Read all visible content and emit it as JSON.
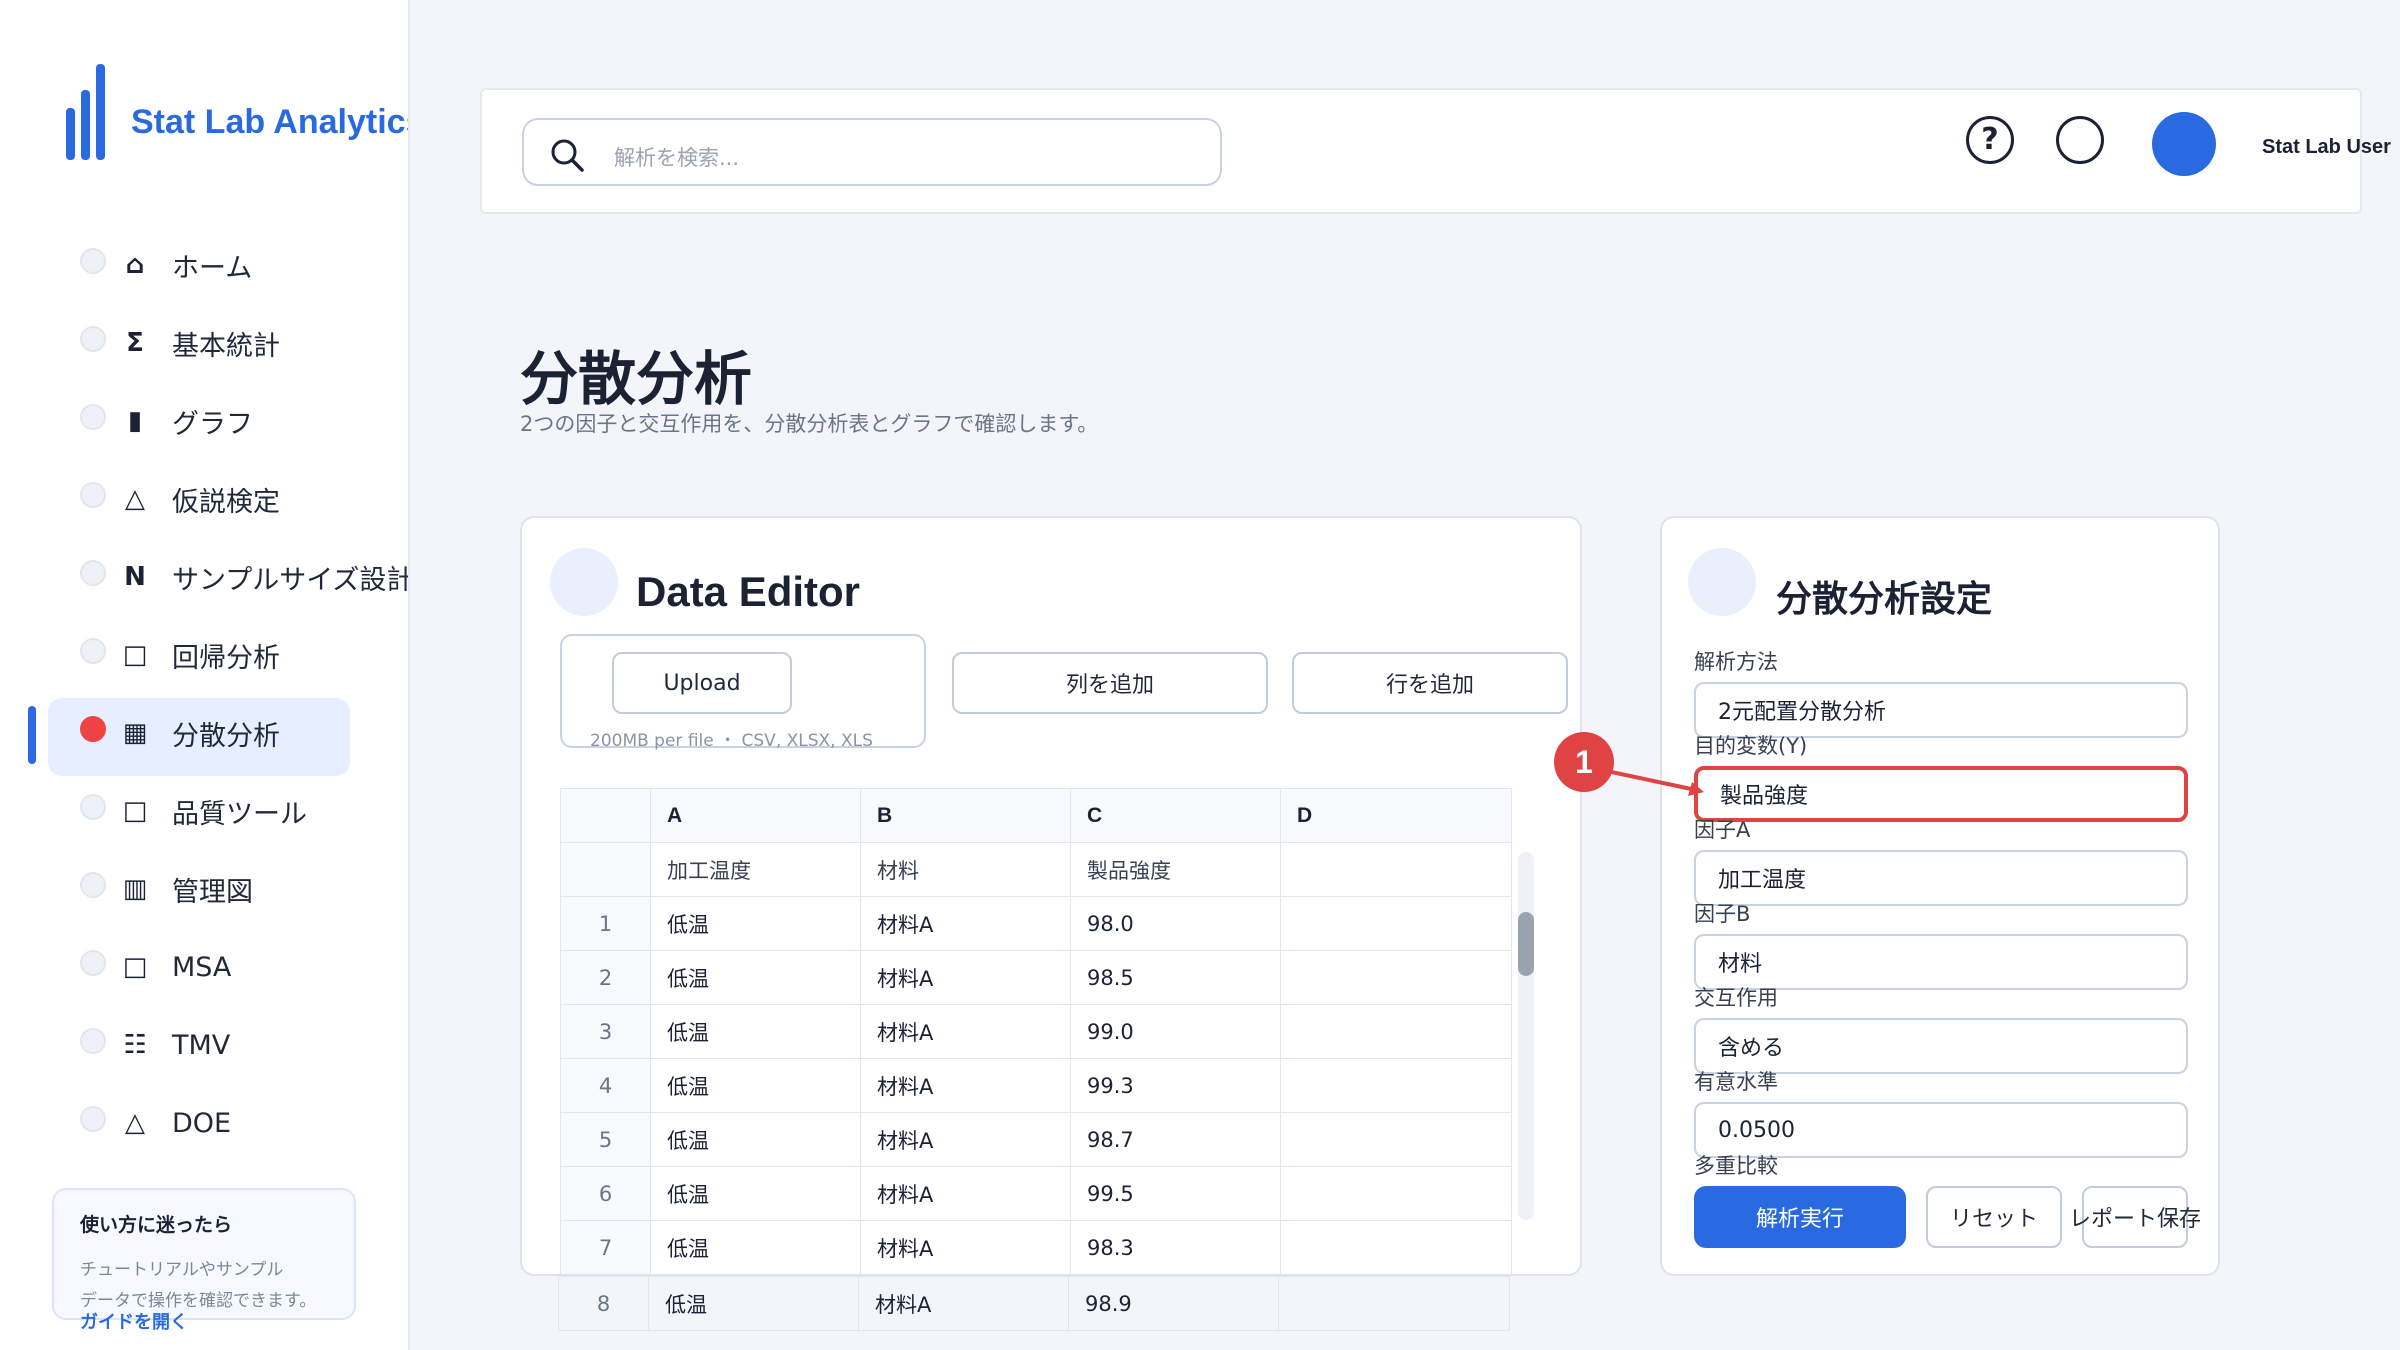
{
  "app": {
    "name": "Stat Lab Analytics",
    "brand_color": "#2a6ae0"
  },
  "sidebar": {
    "items": [
      {
        "label": "ホーム",
        "icon": "⌂",
        "icon_name": "home-icon"
      },
      {
        "label": "基本統計",
        "icon": "Σ",
        "icon_name": "sigma-icon"
      },
      {
        "label": "グラフ",
        "icon": "▮",
        "icon_name": "chart-icon"
      },
      {
        "label": "仮説検定",
        "icon": "△",
        "icon_name": "triangle-icon"
      },
      {
        "label": "サンプルサイズ設計",
        "icon": "N",
        "icon_name": "n-icon"
      },
      {
        "label": "回帰分析",
        "icon": "□",
        "icon_name": "square-icon"
      },
      {
        "label": "分散分析",
        "icon": "▦",
        "icon_name": "grid-icon",
        "active": true
      },
      {
        "label": "品質ツール",
        "icon": "□",
        "icon_name": "square-icon"
      },
      {
        "label": "管理図",
        "icon": "▥",
        "icon_name": "control-chart-icon"
      },
      {
        "label": "MSA",
        "icon": "□",
        "icon_name": "square-icon"
      },
      {
        "label": "TMV",
        "icon": "☷",
        "icon_name": "list-icon"
      },
      {
        "label": "DOE",
        "icon": "△",
        "icon_name": "triangle-icon"
      }
    ],
    "help": {
      "title": "使い方に迷ったら",
      "text_line1": "チュートリアルやサンプル",
      "text_line2": "データで操作を確認できます。",
      "link": "ガイドを開く"
    }
  },
  "header": {
    "search_placeholder": "解析を検索...",
    "help_icon": "?",
    "user_name": "Stat Lab User"
  },
  "page": {
    "title": "分散分析",
    "subtitle": "2つの因子と交互作用を、分散分析表とグラフで確認します。"
  },
  "editor": {
    "title": "Data Editor",
    "upload_label": "Upload",
    "upload_hint": "200MB per file ・ CSV, XLSX, XLS",
    "add_column": "列を追加",
    "add_row": "行を追加",
    "columns": [
      "A",
      "B",
      "C",
      "D"
    ],
    "header_row": [
      "加工温度",
      "材料",
      "製品強度",
      ""
    ],
    "rows": [
      {
        "n": "1",
        "a": "低温",
        "b": "材料A",
        "c": "98.0"
      },
      {
        "n": "2",
        "a": "低温",
        "b": "材料A",
        "c": "98.5"
      },
      {
        "n": "3",
        "a": "低温",
        "b": "材料A",
        "c": "99.0"
      },
      {
        "n": "4",
        "a": "低温",
        "b": "材料A",
        "c": "99.3"
      },
      {
        "n": "5",
        "a": "低温",
        "b": "材料A",
        "c": "98.7"
      },
      {
        "n": "6",
        "a": "低温",
        "b": "材料A",
        "c": "99.5"
      },
      {
        "n": "7",
        "a": "低温",
        "b": "材料A",
        "c": "98.3"
      }
    ],
    "overflow_rows": [
      {
        "n": "8",
        "a": "低温",
        "b": "材料A",
        "c": "98.9"
      }
    ]
  },
  "settings": {
    "title": "分散分析設定",
    "method_label": "解析方法",
    "method_value": "2元配置分散分析",
    "target_label": "目的変数(Y)",
    "target_value": "製品強度",
    "factor_a_label": "因子A",
    "factor_a_value": "加工温度",
    "factor_b_label": "因子B",
    "factor_b_value": "材料",
    "interaction_label": "交互作用",
    "interaction_value": "含める",
    "alpha_label": "有意水準",
    "alpha_value": "0.0500",
    "multiple_label": "多重比較",
    "run_button": "解析実行",
    "reset_button": "リセット",
    "save_button": "レポート保存"
  },
  "annotation": {
    "marker": "1",
    "color": "#e04343"
  }
}
